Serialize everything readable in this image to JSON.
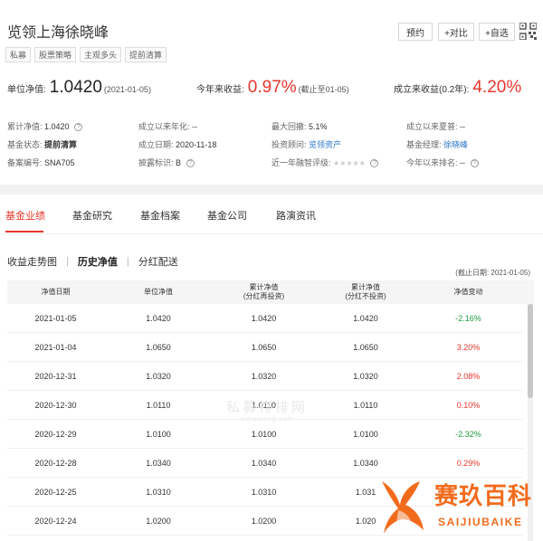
{
  "fund": {
    "title": "览领上海徐晓峰",
    "tags": [
      "私募",
      "股票策略",
      "主观多头",
      "提前清算"
    ]
  },
  "actions": {
    "book": "预约",
    "compare": "+对比",
    "watch": "+自选"
  },
  "nav": {
    "label": "单位净值:",
    "value": "1.0420",
    "date": "(2021-01-05)",
    "ytd_label": "今年来收益:",
    "ytd_value": "0.97%",
    "ytd_note": "(截止至01-05)",
    "since_label": "成立来收益(0.2年):",
    "since_value": "4.20%"
  },
  "info": {
    "cum_nav_label": "累计净值:",
    "cum_nav_value": "1.0420",
    "annual_label": "成立以来年化:",
    "annual_value": "--",
    "drawdown_label": "最大回撤:",
    "drawdown_value": "5.1%",
    "sharpe_label": "成立以来夏普:",
    "sharpe_value": "--",
    "status_label": "基金状态:",
    "status_value": "提前清算",
    "found_label": "成立日期:",
    "found_value": "2020-11-18",
    "advisor_label": "投资顾问:",
    "advisor_value": "览领资产",
    "manager_label": "基金经理:",
    "manager_value": "徐晓峰",
    "record_label": "备案编号:",
    "record_value": "SNA705",
    "disclose_label": "披露标识:",
    "disclose_value": "B",
    "rating_label": "近一年融智评级:",
    "rating_stars": "★★★★★",
    "rank_label": "今年以来排名:",
    "rank_value": "--"
  },
  "tabs": [
    "基金业绩",
    "基金研究",
    "基金档案",
    "基金公司",
    "路演资讯"
  ],
  "subtabs": {
    "trend": "收益走势图",
    "history": "历史净值",
    "dividend": "分红配送",
    "sep": "|"
  },
  "update_note": "(截止日期: 2021-01-05)",
  "table": {
    "headers": {
      "date": "净值日期",
      "unit_nav": "单位净值",
      "cum_reinv_1": "累计净值",
      "cum_reinv_2": "(分红再投资)",
      "cum_noreinv_1": "累计净值",
      "cum_noreinv_2": "(分红不投资)",
      "change": "净值变动"
    },
    "rows": [
      {
        "date": "2021-01-05",
        "unit": "1.0420",
        "cum1": "1.0420",
        "cum2": "1.0420",
        "chg": "-2.16%"
      },
      {
        "date": "2021-01-04",
        "unit": "1.0650",
        "cum1": "1.0650",
        "cum2": "1.0650",
        "chg": "3.20%"
      },
      {
        "date": "2020-12-31",
        "unit": "1.0320",
        "cum1": "1.0320",
        "cum2": "1.0320",
        "chg": "2.08%"
      },
      {
        "date": "2020-12-30",
        "unit": "1.0110",
        "cum1": "1.0110",
        "cum2": "1.0110",
        "chg": "0.10%"
      },
      {
        "date": "2020-12-29",
        "unit": "1.0100",
        "cum1": "1.0100",
        "cum2": "1.0100",
        "chg": "-2.32%"
      },
      {
        "date": "2020-12-28",
        "unit": "1.0340",
        "cum1": "1.0340",
        "cum2": "1.0340",
        "chg": "0.29%"
      },
      {
        "date": "2020-12-25",
        "unit": "1.0310",
        "cum1": "1.0310",
        "cum2": "1.031",
        "chg": ""
      },
      {
        "date": "2020-12-24",
        "unit": "1.0200",
        "cum1": "1.0200",
        "cum2": "1.020",
        "chg": ""
      }
    ]
  },
  "watermark": {
    "line1": "私募排排网",
    "line2": "simuwang.com"
  },
  "brand": {
    "cn": "赛玖百科",
    "en": "SAIJIUBAIKE"
  },
  "colors": {
    "accent_red": "#e8352b",
    "negative_green": "#1e9a3b",
    "link_blue": "#2a76c9",
    "brand_orange": "#f26b1d"
  }
}
